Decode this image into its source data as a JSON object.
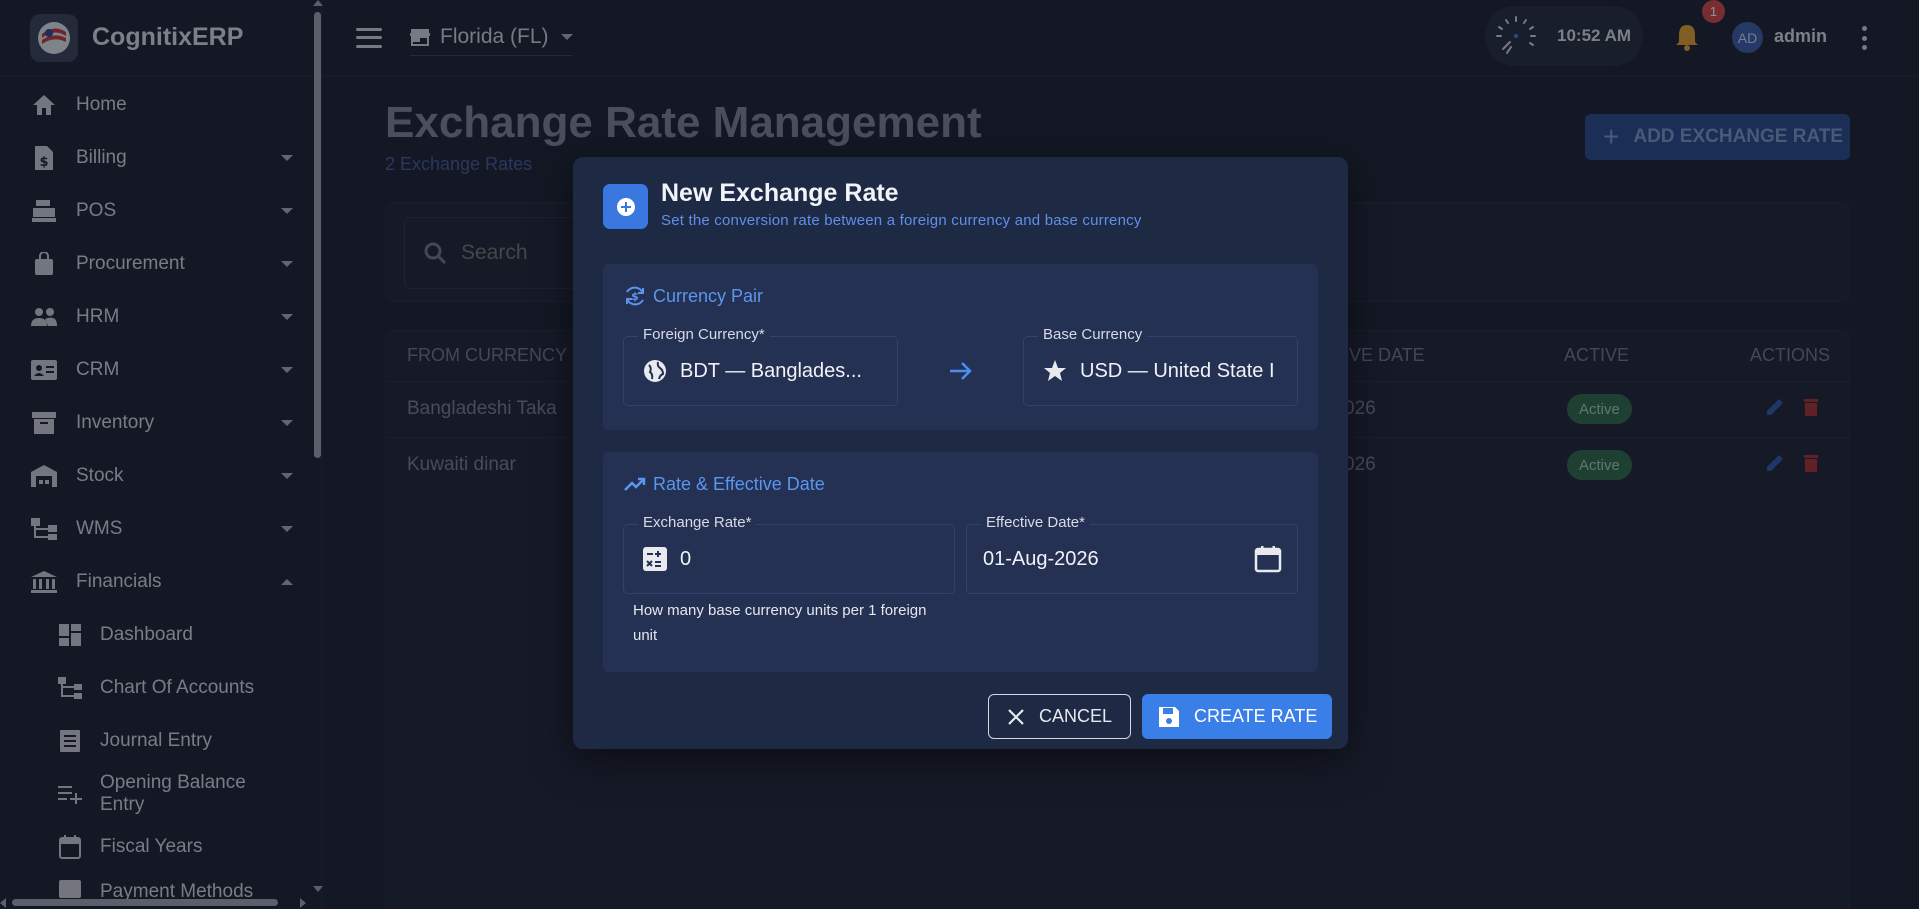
{
  "brand": {
    "name": "CognitixERP"
  },
  "sidebar": {
    "items": [
      {
        "label": "Home",
        "icon": "home-icon"
      },
      {
        "label": "Billing",
        "icon": "invoice-dollar-icon"
      },
      {
        "label": "POS",
        "icon": "cash-register-icon"
      },
      {
        "label": "Procurement",
        "icon": "shopping-bag-icon"
      },
      {
        "label": "HRM",
        "icon": "people-icon"
      },
      {
        "label": "CRM",
        "icon": "contact-card-icon"
      },
      {
        "label": "Inventory",
        "icon": "archive-icon"
      },
      {
        "label": "Stock",
        "icon": "warehouse-icon"
      },
      {
        "label": "WMS",
        "icon": "hierarchy-icon"
      },
      {
        "label": "Financials",
        "icon": "bank-icon"
      }
    ],
    "financials_sub": [
      {
        "label": "Dashboard",
        "icon": "dashboard-icon"
      },
      {
        "label": "Chart Of Accounts",
        "icon": "hierarchy-icon"
      },
      {
        "label": "Journal Entry",
        "icon": "journal-icon"
      },
      {
        "label": "Opening Balance Entry",
        "icon": "playlist-add-icon"
      },
      {
        "label": "Fiscal Years",
        "icon": "calendar-icon"
      },
      {
        "label": "Payment Methods",
        "icon": "card-icon"
      }
    ]
  },
  "topbar": {
    "location": "Florida (FL)",
    "time": "10:52 AM",
    "notification_count": "1",
    "avatar_initials": "AD",
    "username": "admin"
  },
  "page": {
    "title": "Exchange Rate Management",
    "subtitle": "2 Exchange Rates",
    "add_button": "ADD EXCHANGE RATE",
    "search_placeholder": "Search"
  },
  "table": {
    "headers": {
      "from": "FROM CURRENCY",
      "date": "IVE DATE",
      "active": "ACTIVE",
      "actions": "ACTIONS"
    },
    "rows": [
      {
        "from": "Bangladeshi Taka",
        "date": "026",
        "status": "Active"
      },
      {
        "from": "Kuwaiti dinar",
        "date": "026",
        "status": "Active"
      }
    ]
  },
  "modal": {
    "title": "New Exchange Rate",
    "subtitle": "Set the conversion rate between a foreign currency and base currency",
    "currency_pair": {
      "heading": "Currency Pair",
      "foreign_label": "Foreign Currency*",
      "foreign_value": "BDT — Banglades...",
      "base_label": "Base Currency",
      "base_value": "USD — United State I"
    },
    "rate_section": {
      "heading": "Rate & Effective Date",
      "rate_label": "Exchange Rate*",
      "rate_value": "0",
      "date_label": "Effective Date*",
      "date_value": "01-Aug-2026",
      "helper": "How many base currency units per 1 foreign unit"
    },
    "cancel_label": "CANCEL",
    "create_label": "CREATE RATE"
  },
  "colors": {
    "accent": "#3a7ee8",
    "active_pill": "#2e6a4a",
    "delete": "#c83a3a",
    "bell": "#e0a030"
  }
}
